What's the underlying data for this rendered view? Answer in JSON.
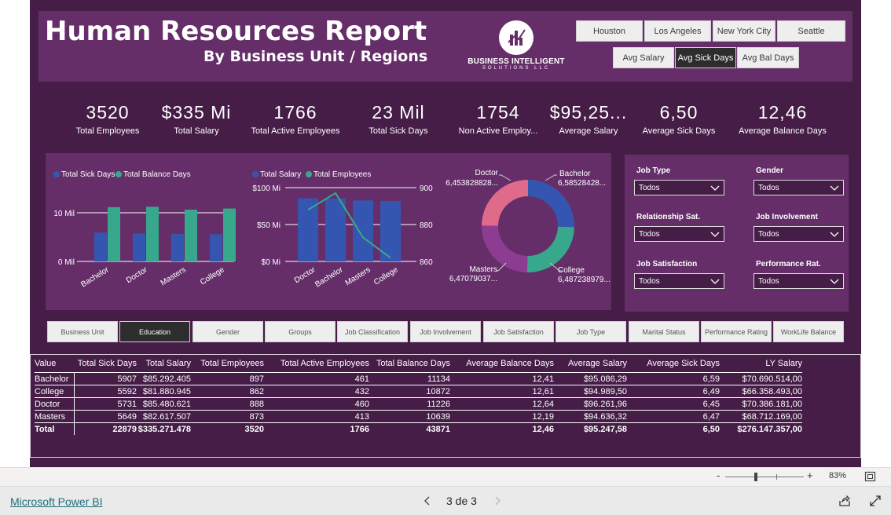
{
  "header": {
    "title": "Human Resources Report",
    "subtitle": "By Business Unit / Regions",
    "logo_line1": "BUSINESS INTELLIGENT",
    "logo_line2": "SOLUTIONS LLC",
    "logo_mark": "BI"
  },
  "city_buttons": [
    "Houston",
    "Los Angeles",
    "New York City",
    "Seattle"
  ],
  "metric_buttons": [
    {
      "label": "Avg Salary",
      "selected": false
    },
    {
      "label": "Avg Sick Days",
      "selected": true
    },
    {
      "label": "Avg Bal Days",
      "selected": false
    }
  ],
  "kpis": [
    {
      "value": "3520",
      "label": "Total Employees"
    },
    {
      "value": "$335 Mi",
      "label": "Total Salary"
    },
    {
      "value": "1766",
      "label": "Total Active Employees"
    },
    {
      "value": "23 Mil",
      "label": "Total Sick Days"
    },
    {
      "value": "1754",
      "label": "Non Active Employ..."
    },
    {
      "value": "$95,25...",
      "label": "Average Salary"
    },
    {
      "value": "6,50",
      "label": "Average Sick Days"
    },
    {
      "value": "12,46",
      "label": "Average Balance Days"
    }
  ],
  "colors": {
    "blue": "#3556b0",
    "teal": "#38a88c",
    "pink": "#df6a8a",
    "purple": "#8c3c91",
    "panel": "#652e69",
    "bg": "#451d47"
  },
  "chart_data": [
    {
      "type": "bar",
      "categories": [
        "Bachelor",
        "Doctor",
        "Masters",
        "College"
      ],
      "series": [
        {
          "name": "Total Sick Days",
          "values": [
            5907,
            5731,
            5649,
            5592
          ],
          "color": "#3556b0"
        },
        {
          "name": "Total Balance Days",
          "values": [
            11134,
            11226,
            10639,
            10872
          ],
          "color": "#38a88c"
        }
      ],
      "yticks": [
        "0 Mil",
        "10 Mil"
      ],
      "ylim": [
        0,
        15000
      ]
    },
    {
      "type": "bar",
      "categories": [
        "Doctor",
        "Bachelor",
        "Masters",
        "College"
      ],
      "series": [
        {
          "name": "Total Salary",
          "values": [
            85480621,
            85292405,
            82617507,
            81880945
          ],
          "color": "#3556b0",
          "kind": "bar"
        },
        {
          "name": "Total Employees",
          "values": [
            888,
            897,
            873,
            862
          ],
          "color": "#38a88c",
          "kind": "line"
        }
      ],
      "yticks_left": [
        "$0 Mi",
        "$50 Mi",
        "$100 Mi"
      ],
      "yticks_right": [
        "860",
        "880",
        "900"
      ],
      "ylim_left": [
        0,
        100000000
      ],
      "ylim_right": [
        860,
        900
      ]
    },
    {
      "type": "pie",
      "categories": [
        "Bachelor",
        "College",
        "Masters",
        "Doctor"
      ],
      "values": [
        6.58528428,
        6.48723897,
        6.47079037,
        6.45382882
      ],
      "labels": [
        "6,58528428...",
        "6,487238979...",
        "6,47079037...",
        "6,453828828..."
      ],
      "colors": [
        "#3556b0",
        "#38a88c",
        "#8c3c91",
        "#df6a8a"
      ]
    }
  ],
  "filters": [
    {
      "label": "Job Type",
      "value": "Todos"
    },
    {
      "label": "Gender",
      "value": "Todos"
    },
    {
      "label": "Relationship Sat.",
      "value": "Todos"
    },
    {
      "label": "Job Involvement",
      "value": "Todos"
    },
    {
      "label": "Job Satisfaction",
      "value": "Todos"
    },
    {
      "label": "Performance Rat.",
      "value": "Todos"
    }
  ],
  "tabs": [
    {
      "label": "Business Unit",
      "selected": false
    },
    {
      "label": "Education",
      "selected": true
    },
    {
      "label": "Gender",
      "selected": false
    },
    {
      "label": "Groups",
      "selected": false
    },
    {
      "label": "Job Classification",
      "selected": false
    },
    {
      "label": "Job Involvement",
      "selected": false
    },
    {
      "label": "Job Satisfaction",
      "selected": false
    },
    {
      "label": "Job Type",
      "selected": false
    },
    {
      "label": "Marital Status",
      "selected": false
    },
    {
      "label": "Performance Rating",
      "selected": false
    },
    {
      "label": "WorkLife Balance",
      "selected": false
    }
  ],
  "table": {
    "columns": [
      "Value",
      "Total Sick Days",
      "Total Salary",
      "Total Employees",
      "Total Active Employees",
      "Total Balance Days",
      "Average Balance Days",
      "Average Salary",
      "Average Sick Days",
      "LY Salary"
    ],
    "rows": [
      [
        "Bachelor",
        "5907",
        "$85.292.405",
        "897",
        "461",
        "11134",
        "12,41",
        "$95.086,29",
        "6,59",
        "$70.690.514,00"
      ],
      [
        "College",
        "5592",
        "$81.880.945",
        "862",
        "432",
        "10872",
        "12,61",
        "$94.989,50",
        "6,49",
        "$66.358.493,00"
      ],
      [
        "Doctor",
        "5731",
        "$85.480.621",
        "888",
        "460",
        "11226",
        "12,64",
        "$96.261,96",
        "6,45",
        "$70.386.181,00"
      ],
      [
        "Masters",
        "5649",
        "$82.617.507",
        "873",
        "413",
        "10639",
        "12,19",
        "$94.636,32",
        "6,47",
        "$68.712.169,00"
      ]
    ],
    "total": [
      "Total",
      "22879",
      "$335.271.478",
      "3520",
      "1766",
      "43871",
      "12,46",
      "$95.247,58",
      "6,50",
      "$276.147.357,00"
    ]
  },
  "zoom": {
    "minus": "-",
    "plus": "+",
    "level": "83%"
  },
  "footer": {
    "brand": "Microsoft Power BI",
    "page": "3 de 3"
  }
}
